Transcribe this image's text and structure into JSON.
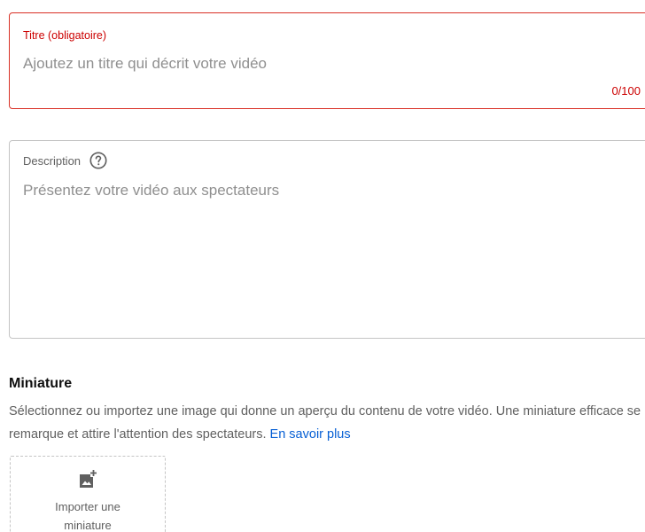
{
  "title_field": {
    "label": "Titre (obligatoire)",
    "placeholder": "Ajoutez un titre qui décrit votre vidéo",
    "counter": "0/100"
  },
  "description_field": {
    "label": "Description",
    "placeholder": "Présentez votre vidéo aux spectateurs",
    "help_icon": "question-circle-icon"
  },
  "thumbnail": {
    "heading": "Miniature",
    "description": "Sélectionnez ou importez une image qui donne un aperçu du contenu de votre vidéo. Une miniature efficace se remarque et attire l'attention des spectateurs.",
    "learn_more": "En savoir plus",
    "upload_label": "Importer une miniature",
    "upload_icon": "add-photo-icon"
  },
  "colors": {
    "error": "#cc0000",
    "link": "#065fd4",
    "placeholder": "#8f8f8f",
    "secondary_text": "#606060"
  }
}
